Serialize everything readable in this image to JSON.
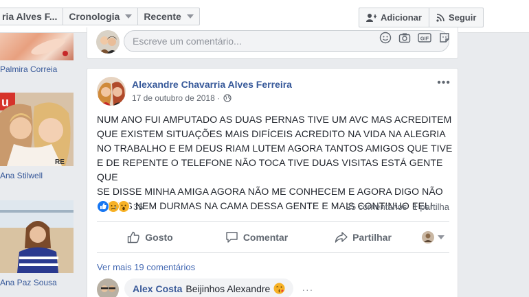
{
  "topbar": {
    "filters": [
      {
        "label": "ria Alves F...",
        "has_caret": false
      },
      {
        "label": "Cronologia",
        "has_caret": true
      },
      {
        "label": "Recente",
        "has_caret": true
      }
    ],
    "add_button": "Adicionar",
    "follow_button": "Seguir"
  },
  "friends": [
    {
      "name": "Palmira Correia"
    },
    {
      "name": "Ana Stilwell"
    },
    {
      "name": "Ana Paz Sousa"
    }
  ],
  "comment_box": {
    "placeholder": "Escreve um comentário...",
    "icons": [
      "emoji-icon",
      "camera-icon",
      "gif-icon",
      "sticker-icon"
    ]
  },
  "post": {
    "author": "Alexandre Chavarria Alves Ferreira",
    "date": "17 de outubro de 2018 · ",
    "text_lines": [
      "NUM ANO FUI AMPUTADO AS DUAS PERNAS TIVE UM AVC MAS ACREDITEM",
      "QUE EXISTEM SITUAÇÕES MAIS DIFÍCEIS ACREDITO NA VIDA NA ALEGRIA",
      "NO TRABALHO E EM DEUS RIAM LUTEM AGORA TANTOS AMIGOS QUE TIVE",
      "E DE REPENTE O TELEFONE NÃO TOCA TIVE DUAS VISITAS ESTÁ GENTE QUE",
      "SE DISSE MINHA AMIGA AGORA NÃO ME CONHECEM E AGORA DIGO NÃO",
      "COMAS NEM DURMAS NA CAMA DESSA GENTE E MAIS CONTINUO FELI"
    ],
    "reaction_count": "35",
    "comments_count": "25 comentários",
    "shares_count": "1 partilha",
    "actions": {
      "like": "Gosto",
      "comment": "Comentar",
      "share": "Partilhar"
    },
    "more_comments": "Ver mais 19 comentários",
    "comment": {
      "author": "Alex Costa",
      "text": "Beijinhos Alexandre"
    }
  },
  "colors": {
    "link": "#365899",
    "like_blue": "#1877f2",
    "wow_yellow": "#f7b125"
  }
}
